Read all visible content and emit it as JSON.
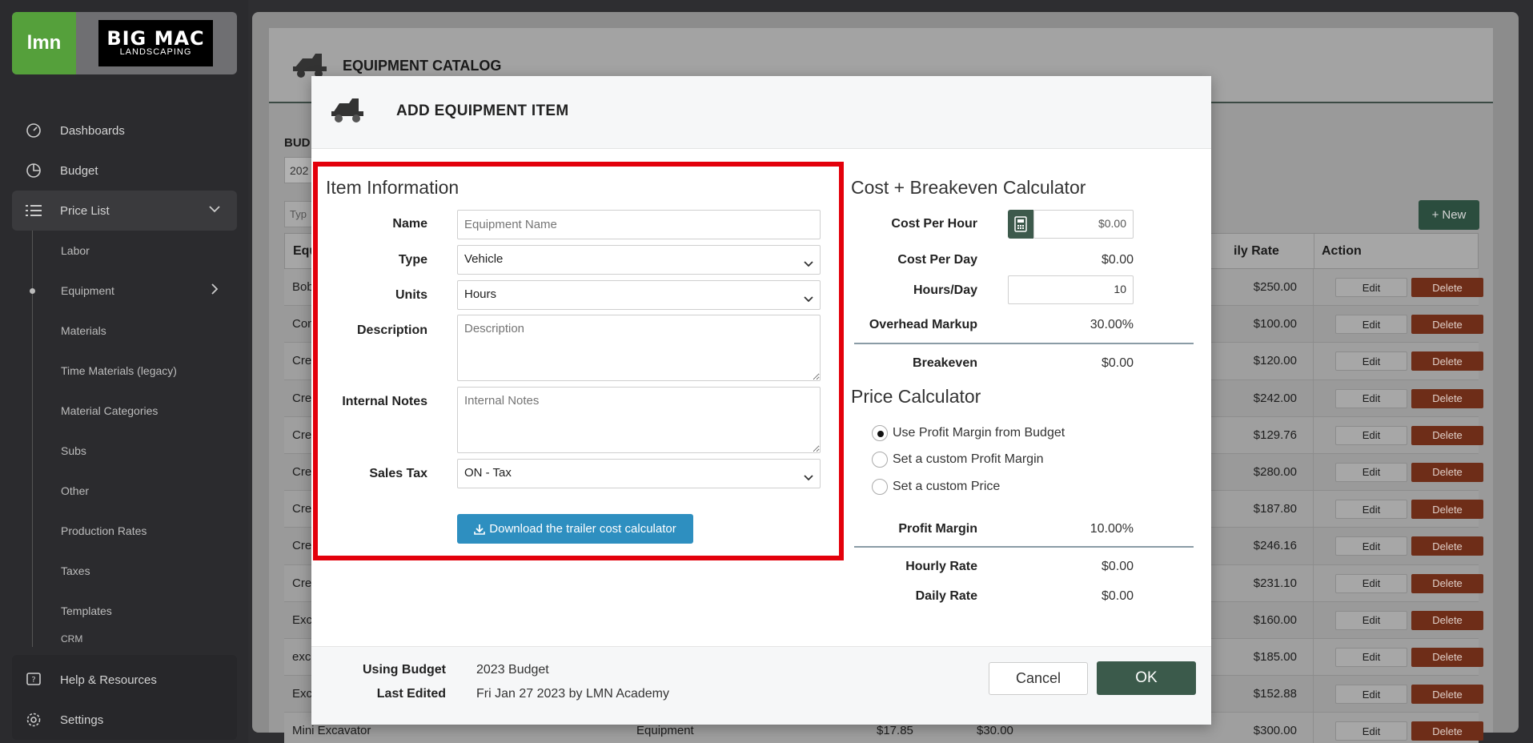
{
  "sidebar": {
    "brand_lmn": "lmn",
    "brand_company_1": "BIG MAC",
    "brand_company_2": "LANDSCAPING",
    "nav": [
      {
        "label": "Dashboards",
        "icon": "gauge-icon"
      },
      {
        "label": "Budget",
        "icon": "pie-chart-icon"
      },
      {
        "label": "Price List",
        "icon": "list-icon"
      }
    ],
    "price_list_items": [
      "Labor",
      "Equipment",
      "Materials",
      "Time Materials (legacy)",
      "Material Categories",
      "Subs",
      "Other",
      "Production Rates",
      "Taxes",
      "Templates",
      "CRM"
    ],
    "bottom": [
      {
        "label": "Help & Resources",
        "icon": "help-icon"
      },
      {
        "label": "Settings",
        "icon": "gear-icon"
      }
    ]
  },
  "catalog": {
    "title": "EQUIPMENT CATALOG",
    "budget_label": "BUD",
    "budget_value": "202",
    "type_placeholder": "Typ",
    "new_button": "New",
    "headers": {
      "name": "Equ",
      "daily_rate": "ily Rate",
      "action": "Action"
    },
    "rows": [
      {
        "name": "Bob",
        "rate": "$250.00"
      },
      {
        "name": "Con",
        "rate": "$100.00"
      },
      {
        "name": "Cre",
        "rate": "$120.00"
      },
      {
        "name": "Cre",
        "rate": "$242.00"
      },
      {
        "name": "Cre",
        "rate": "$129.76"
      },
      {
        "name": "Cre",
        "rate": "$280.00"
      },
      {
        "name": "Cre",
        "rate": "$187.80"
      },
      {
        "name": "Cre",
        "rate": "$246.16"
      },
      {
        "name": "Cre",
        "rate": "$231.10"
      },
      {
        "name": "Exc",
        "rate": "$160.00"
      },
      {
        "name": "exc",
        "rate": "$185.00"
      },
      {
        "name": "Exc",
        "rate": "$152.88"
      },
      {
        "name": "Mini Excavator",
        "rate": "$300.00"
      }
    ],
    "last_row_type": "Equipment",
    "last_row_hourly": "$17.85",
    "last_row_x": "$30.00",
    "edit_label": "Edit",
    "delete_label": "Delete"
  },
  "modal": {
    "title": "ADD EQUIPMENT ITEM",
    "item_info": {
      "title": "Item Information",
      "name_label": "Name",
      "name_placeholder": "Equipment Name",
      "type_label": "Type",
      "type_value": "Vehicle",
      "units_label": "Units",
      "units_value": "Hours",
      "description_label": "Description",
      "description_placeholder": "Description",
      "notes_label": "Internal Notes",
      "notes_placeholder": "Internal Notes",
      "tax_label": "Sales Tax",
      "tax_value": "ON - Tax",
      "download_button": "Download the trailer cost calculator"
    },
    "breakeven": {
      "title": "Cost + Breakeven Calculator",
      "cost_hour_label": "Cost Per Hour",
      "cost_hour_value": "$0.00",
      "cost_day_label": "Cost Per Day",
      "cost_day_value": "$0.00",
      "hours_day_label": "Hours/Day",
      "hours_day_value": "10",
      "overhead_label": "Overhead Markup",
      "overhead_value": "30.00%",
      "breakeven_label": "Breakeven",
      "breakeven_value": "$0.00"
    },
    "price": {
      "title": "Price Calculator",
      "options": [
        "Use Profit Margin from Budget",
        "Set a custom Profit Margin",
        "Set a custom Price"
      ],
      "selected_index": 0,
      "margin_label": "Profit Margin",
      "margin_value": "10.00%",
      "hourly_label": "Hourly Rate",
      "hourly_value": "$0.00",
      "daily_label": "Daily Rate",
      "daily_value": "$0.00"
    },
    "footer": {
      "using_budget_label": "Using Budget",
      "using_budget_value": "2023 Budget",
      "last_edited_label": "Last Edited",
      "last_edited_value": "Fri Jan 27 2023 by LMN Academy",
      "cancel": "Cancel",
      "ok": "OK"
    }
  },
  "colors": {
    "highlight": "#e3000b",
    "primary_green": "#3b5a4b",
    "download_blue": "#2e8fc0",
    "brand_green": "#55a03b"
  }
}
